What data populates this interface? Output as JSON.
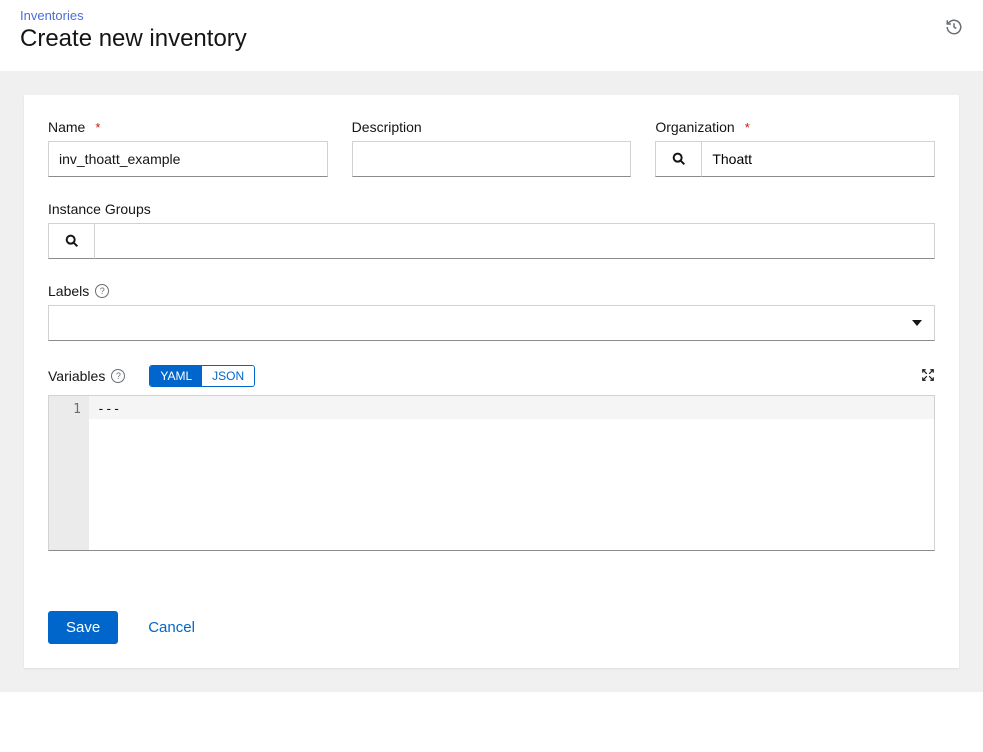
{
  "breadcrumb": {
    "inventories": "Inventories"
  },
  "page_title": "Create new inventory",
  "form": {
    "name_label": "Name",
    "name_value": "inv_thoatt_example",
    "description_label": "Description",
    "description_value": "",
    "organization_label": "Organization",
    "organization_value": "Thoatt",
    "instance_groups_label": "Instance Groups",
    "instance_groups_value": "",
    "labels_label": "Labels",
    "variables_label": "Variables",
    "toggle_yaml": "YAML",
    "toggle_json": "JSON"
  },
  "code": {
    "gutter_1": "1",
    "line_1": "---"
  },
  "actions": {
    "save": "Save",
    "cancel": "Cancel"
  }
}
